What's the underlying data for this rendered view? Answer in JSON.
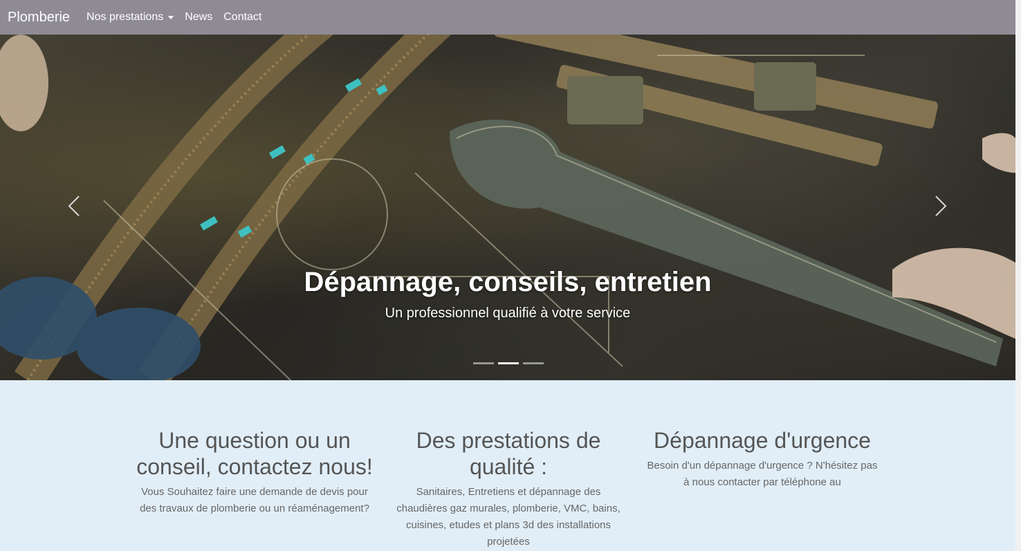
{
  "nav": {
    "brand": "Plomberie",
    "items": [
      {
        "label": "Nos prestations",
        "dropdown": true
      },
      {
        "label": "News"
      },
      {
        "label": "Contact"
      }
    ]
  },
  "carousel": {
    "title": "Dépannage, conseils, entretien",
    "subtitle": "Un professionnel qualifié à votre service",
    "slide_count": 3,
    "active_index": 1
  },
  "features": [
    {
      "title": "Une question ou un conseil, contactez nous!",
      "text": "Vous Souhaitez faire une demande de devis pour des travaux de plomberie ou un réaménagement?"
    },
    {
      "title": "Des prestations de qualité :",
      "text": "Sanitaires, Entretiens et dépannage des chaudières gaz murales, plomberie, VMC, bains, cuisines, etudes et plans 3d des installations projetées"
    },
    {
      "title": "Dépannage d'urgence",
      "text": "Besoin d'un dépannage d'urgence ? N'hésitez pas à nous contacter par téléphone au"
    }
  ],
  "colors": {
    "navbar": "#8f8b94",
    "features_bg": "#e1eef8",
    "heading": "#555555"
  },
  "icons": {
    "prev": "chevron-left-icon",
    "next": "chevron-right-icon",
    "dropdown": "caret-down-icon"
  }
}
